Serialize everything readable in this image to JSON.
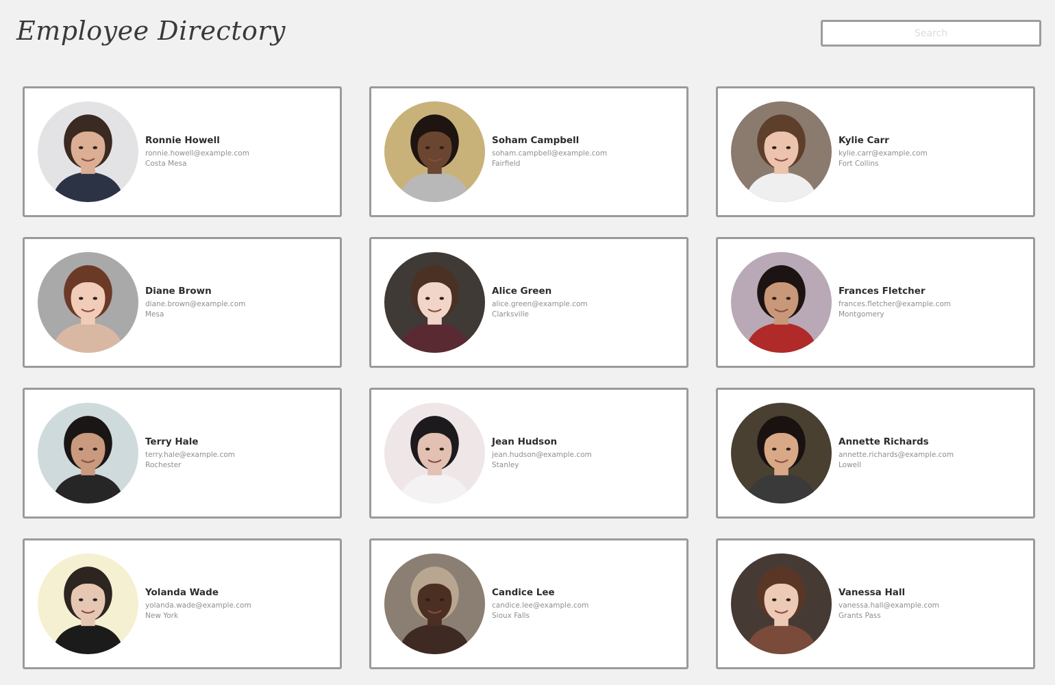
{
  "header": {
    "title": "Employee Directory",
    "search_placeholder": "Search"
  },
  "employees": [
    {
      "name": "Ronnie Howell",
      "email": "ronnie.howell@example.com",
      "city": "Costa Mesa",
      "bg": "#e3e3e6",
      "skin": "#dcae93",
      "hair": "#3b2a22",
      "shirt": "#2c3345"
    },
    {
      "name": "Soham Campbell",
      "email": "soham.campbell@example.com",
      "city": "Fairfield",
      "bg": "#c9b27a",
      "skin": "#6a4530",
      "hair": "#1e1410",
      "shirt": "#b8b8b8"
    },
    {
      "name": "Kylie Carr",
      "email": "kylie.carr@example.com",
      "city": "Fort Collins",
      "bg": "#8b7a6e",
      "skin": "#ecc3ac",
      "hair": "#5e3f2c",
      "shirt": "#efefef"
    },
    {
      "name": "Diane Brown",
      "email": "diane.brown@example.com",
      "city": "Mesa",
      "bg": "#a9a9a9",
      "skin": "#f1ccb8",
      "hair": "#6b3a26",
      "shirt": "#d9b8a3"
    },
    {
      "name": "Alice Green",
      "email": "alice.green@example.com",
      "city": "Clarksville",
      "bg": "#3f3a36",
      "skin": "#f0d5c8",
      "hair": "#4a3123",
      "shirt": "#5a2a33"
    },
    {
      "name": "Frances Fletcher",
      "email": "frances.fletcher@example.com",
      "city": "Montgomery",
      "bg": "#b9a9b6",
      "skin": "#c99878",
      "hair": "#1c1412",
      "shirt": "#b02a2a"
    },
    {
      "name": "Terry Hale",
      "email": "terry.hale@example.com",
      "city": "Rochester",
      "bg": "#cfdadc",
      "skin": "#c99a7e",
      "hair": "#1a1616",
      "shirt": "#262626"
    },
    {
      "name": "Jean Hudson",
      "email": "jean.hudson@example.com",
      "city": "Stanley",
      "bg": "#efe6e8",
      "skin": "#e2c1b2",
      "hair": "#1c1a1d",
      "shirt": "#f4f2f2"
    },
    {
      "name": "Annette Richards",
      "email": "annette.richards@example.com",
      "city": "Lowell",
      "bg": "#4a4032",
      "skin": "#d9a886",
      "hair": "#1a1210",
      "shirt": "#3a3a3a"
    },
    {
      "name": "Yolanda Wade",
      "email": "yolanda.wade@example.com",
      "city": "New York",
      "bg": "#f6f0d2",
      "skin": "#e6c7b3",
      "hair": "#2d2520",
      "shirt": "#1b1b1b"
    },
    {
      "name": "Candice Lee",
      "email": "candice.lee@example.com",
      "city": "Sioux Falls",
      "bg": "#8a7f72",
      "skin": "#4a2f22",
      "hair": "#b9a690",
      "shirt": "#3e2a22"
    },
    {
      "name": "Vanessa Hall",
      "email": "vanessa.hall@example.com",
      "city": "Grants Pass",
      "bg": "#463a34",
      "skin": "#eccab5",
      "hair": "#5a3626",
      "shirt": "#7a4a3a"
    }
  ]
}
